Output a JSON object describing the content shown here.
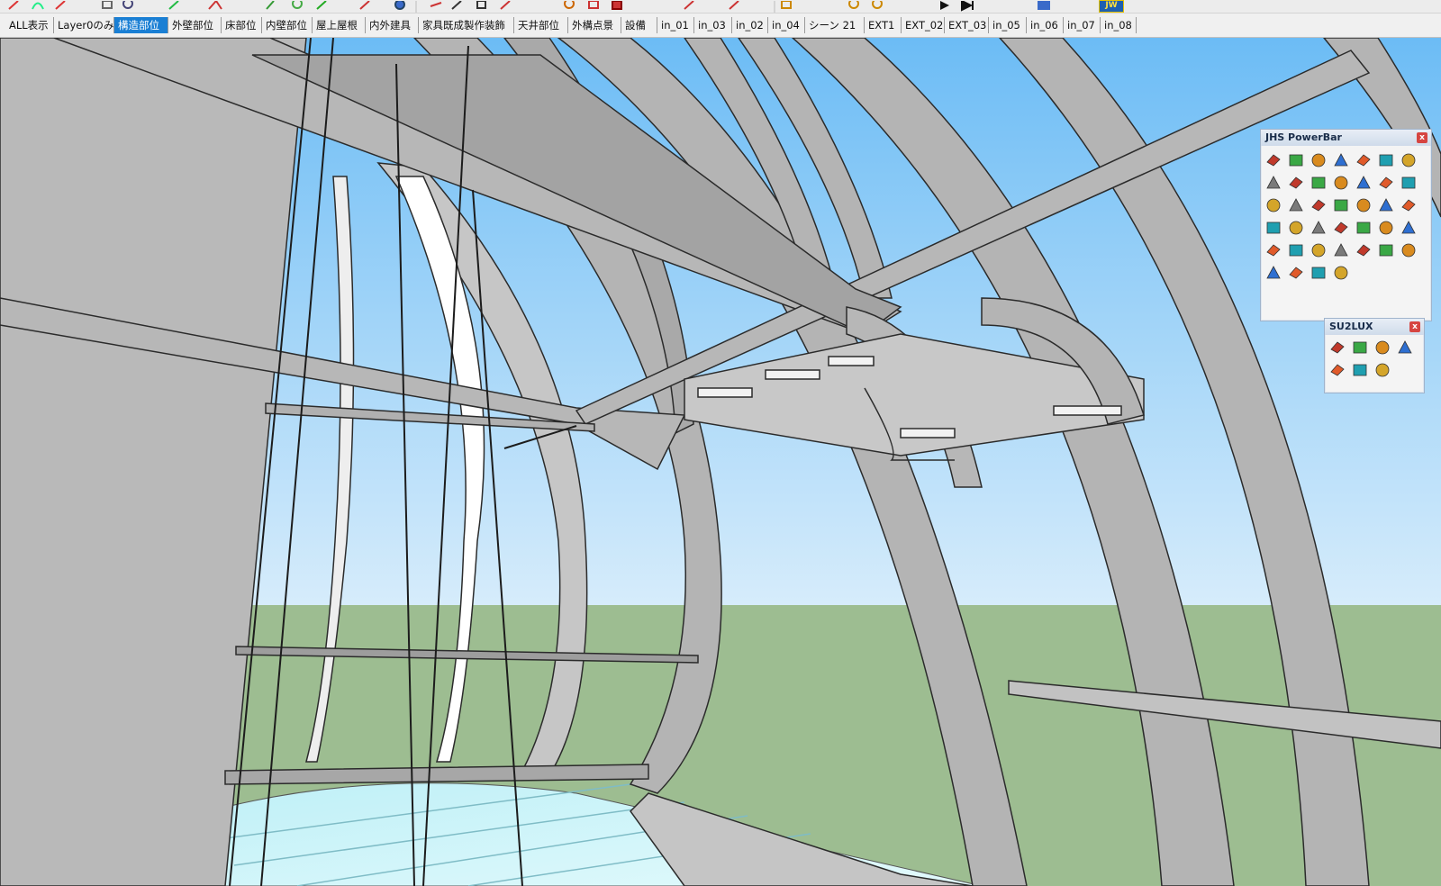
{
  "scene_tabs": [
    {
      "label": "ALL表示",
      "active": false
    },
    {
      "label": "Layer0のみ",
      "active": false
    },
    {
      "label": "構造部位",
      "active": true
    },
    {
      "label": "外壁部位",
      "active": false
    },
    {
      "label": "床部位",
      "active": false
    },
    {
      "label": "内壁部位",
      "active": false
    },
    {
      "label": "屋上屋根",
      "active": false
    },
    {
      "label": "内外建具",
      "active": false
    },
    {
      "label": "家具既成製作装飾",
      "active": false
    },
    {
      "label": "天井部位",
      "active": false
    },
    {
      "label": "外構点景",
      "active": false
    },
    {
      "label": "設備",
      "active": false
    },
    {
      "label": "in_01",
      "active": false
    },
    {
      "label": "in_03",
      "active": false
    },
    {
      "label": "in_02",
      "active": false
    },
    {
      "label": "in_04",
      "active": false
    },
    {
      "label": "シーン 21",
      "active": false
    },
    {
      "label": "EXT1",
      "active": false
    },
    {
      "label": "EXT_02",
      "active": false
    },
    {
      "label": "EXT_03",
      "active": false
    },
    {
      "label": "in_05",
      "active": false
    },
    {
      "label": "in_06",
      "active": false
    },
    {
      "label": "in_07",
      "active": false
    },
    {
      "label": "in_08",
      "active": false
    }
  ],
  "toolbar": {
    "jw_label": "JW",
    "icons": [
      "pencil-icon",
      "arc-icon",
      "line-icon",
      "rect-icon",
      "circle-icon",
      "move-icon",
      "rotate-icon",
      "push-pull-icon",
      "offset-icon",
      "tape-icon",
      "paint-icon",
      "eraser-icon",
      "orbit-icon",
      "pan-icon",
      "zoom-icon",
      "section-icon",
      "walk-icon",
      "look-icon",
      "play-icon",
      "next-icon",
      "layer-icon",
      "jw-icon"
    ]
  },
  "jhs_powerbar": {
    "title": "JHS PowerBar",
    "close": "x",
    "icons": [
      "blue-faces-icon",
      "blue-plane-icon",
      "gold-plane-icon",
      "green-plane-icon",
      "red-plane-icon",
      "outline-plane-icon",
      "curl-icon",
      "red-square-icon",
      "frame-icon",
      "flag-icon",
      "book-icon",
      "link-icon",
      "corner-icon",
      "scatter-red-icon",
      "red-cross-icon",
      "green-cross-icon",
      "blue-x-icon",
      "cone-icon",
      "cone-green-icon",
      "warning-icon",
      "hook-icon",
      "swirl-icon",
      "loop-icon",
      "star-icon",
      "cup-icon",
      "magnet-icon",
      "puzzle-icon",
      "edit-icon",
      "cube-red-icon",
      "cube-red2-icon",
      "gem-icon",
      "chain-icon",
      "grid-icon",
      "tile-icon",
      "tile-orange-icon",
      "orange-grid-icon",
      "red-dots-icon",
      "arc-dots-icon",
      "node-icon"
    ]
  },
  "su2lux": {
    "title": "SU2LUX",
    "close": "x",
    "icons": [
      "export-icon",
      "material-icon",
      "light-icon",
      "flask-icon",
      "texture-icon",
      "settings-panel-icon",
      "gear-icon"
    ]
  },
  "colors": {
    "sky_top": "#6cbcf5",
    "sky_bottom": "#d6ecfb",
    "ground": "#9dbd91",
    "structure": "#b4b4b4",
    "floor_glass": "#c9f1f7",
    "active_tab": "#1a7fd4"
  }
}
